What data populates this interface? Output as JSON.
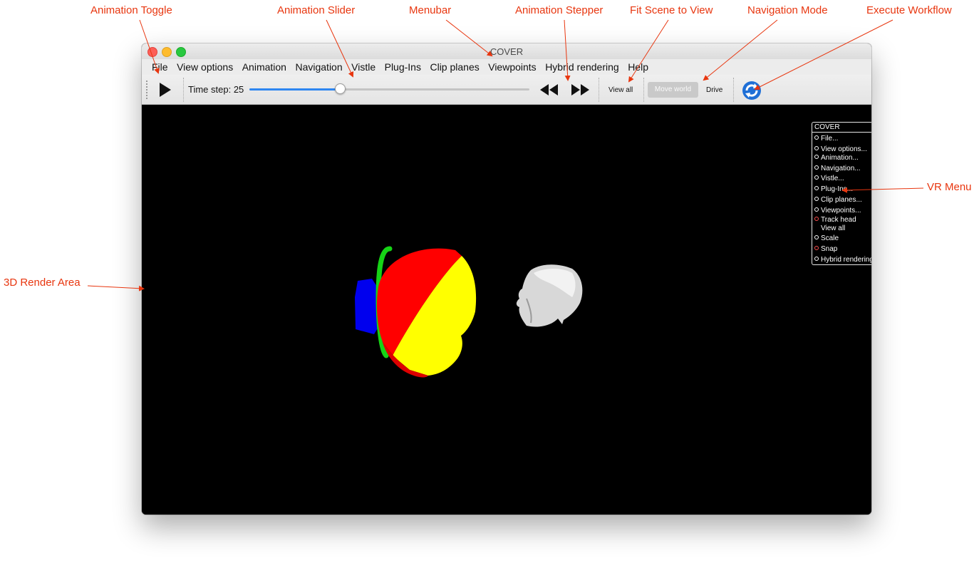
{
  "annotations": {
    "animation_toggle": "Animation Toggle",
    "animation_slider": "Animation Slider",
    "menubar": "Menubar",
    "animation_stepper": "Animation Stepper",
    "fit_scene": "Fit Scene to View",
    "navigation_mode": "Navigation Mode",
    "execute_workflow": "Execute Workflow",
    "vr_menu": "VR Menu",
    "render_area": "3D Render Area"
  },
  "colors": {
    "annotation": "#e8360f",
    "slider_accent": "#2e86f0"
  },
  "window": {
    "title": "COVER"
  },
  "menubar": {
    "items": [
      {
        "label": "File"
      },
      {
        "label": "View options"
      },
      {
        "label": "Animation"
      },
      {
        "label": "Navigation"
      },
      {
        "label": "Vistle"
      },
      {
        "label": "Plug-Ins"
      },
      {
        "label": "Clip planes"
      },
      {
        "label": "Viewpoints"
      },
      {
        "label": "Hybrid rendering"
      },
      {
        "label": "Help"
      }
    ]
  },
  "toolbar": {
    "play_icon": "play-icon",
    "timestep_label": "Time step: 25",
    "slider_fraction": 0.325,
    "step_back_icon": "rewind-icon",
    "step_forward_icon": "fast-forward-icon",
    "view_all_label": "View all",
    "move_world_label": "Move world",
    "drive_label": "Drive",
    "execute_icon": "refresh-icon"
  },
  "vr_menu": {
    "title": "COVER",
    "items": [
      {
        "label": "File...",
        "mark": "circle"
      },
      {
        "label": "View options...",
        "mark": "circle"
      },
      {
        "label": "Animation...",
        "mark": "circle"
      },
      {
        "label": "Navigation...",
        "mark": "circle"
      },
      {
        "label": "Vistle...",
        "mark": "circle"
      },
      {
        "label": "Plug-Ins...",
        "mark": "circle"
      },
      {
        "label": "Clip planes...",
        "mark": "circle"
      },
      {
        "label": "Viewpoints...",
        "mark": "circle"
      },
      {
        "label": "Track head",
        "mark": "checked"
      },
      {
        "label": "View all",
        "mark": "none"
      },
      {
        "label": "Scale",
        "mark": "circle"
      },
      {
        "label": "Snap",
        "mark": "checked"
      },
      {
        "label": "Hybrid rendering...",
        "mark": "circle"
      }
    ]
  }
}
